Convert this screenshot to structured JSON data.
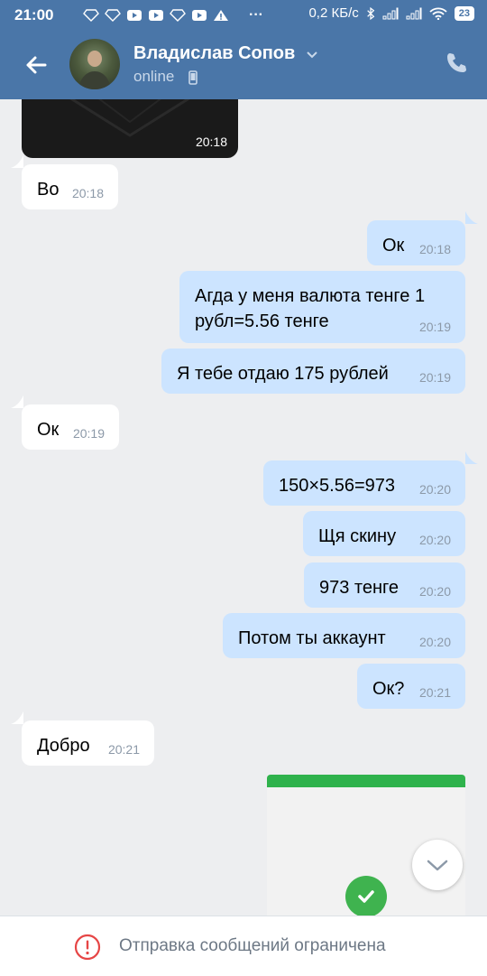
{
  "status_bar": {
    "time": "21:00",
    "speed": "0,2 КБ/с",
    "battery": "23"
  },
  "header": {
    "contact_name": "Владислав Сопов",
    "status": "online"
  },
  "messages": [
    {
      "text": "Во",
      "time": "20:18",
      "dir": "in"
    },
    {
      "text": "Ок",
      "time": "20:18",
      "dir": "out"
    },
    {
      "text": "Агда у меня валюта тенге 1\nрубл=5.56 тенге",
      "line1": "Агда у меня валюта тенге 1",
      "line2": "рубл=5.56 тенге",
      "time": "20:19",
      "dir": "out"
    },
    {
      "text": "Я тебе отдаю 175 рублей",
      "time": "20:19",
      "dir": "out"
    },
    {
      "text": "Ок",
      "time": "20:19",
      "dir": "in"
    },
    {
      "text": "150×5.56=973",
      "time": "20:20",
      "dir": "out"
    },
    {
      "text": "Щя скину",
      "time": "20:20",
      "dir": "out"
    },
    {
      "text": "973 тенге",
      "time": "20:20",
      "dir": "out"
    },
    {
      "text": "Потом ты аккаунт",
      "time": "20:20",
      "dir": "out"
    },
    {
      "text": "Ок?",
      "time": "20:21",
      "dir": "out"
    },
    {
      "text": "Добро",
      "time": "20:21",
      "dir": "in"
    }
  ],
  "video_time": "20:18",
  "bottom_bar": {
    "text": "Отправка сообщений ограничена"
  },
  "colors": {
    "header": "#4a76a8",
    "incoming": "#ffffff",
    "outgoing": "#cce4ff",
    "background": "#edeef0"
  }
}
